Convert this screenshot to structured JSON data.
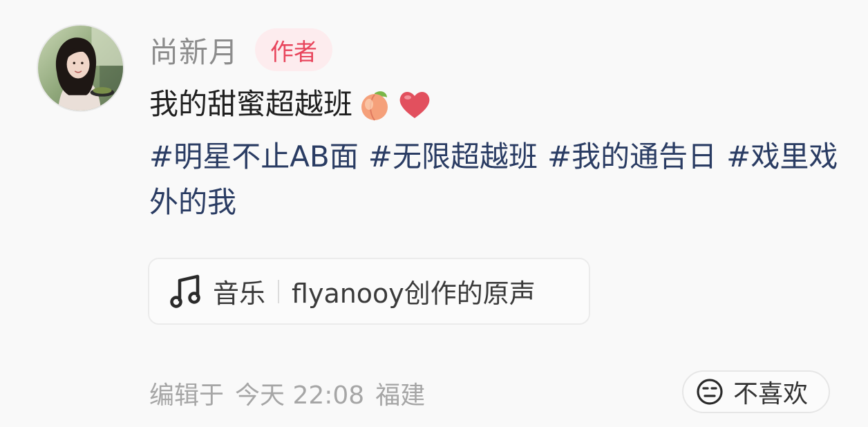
{
  "author": {
    "name": "尚新月",
    "badge": "作者"
  },
  "post": {
    "title": "我的甜蜜超越班",
    "emojis": [
      "peach-emoji",
      "red-heart-emoji"
    ],
    "tags": [
      "#明星不止AB面",
      "#无限超越班",
      "#我的通告日",
      "#戏里戏外的我"
    ]
  },
  "music": {
    "icon": "music-note-icon",
    "label": "音乐",
    "title": "flyanooy创作的原声"
  },
  "footer": {
    "edited_prefix": "编辑于",
    "edited_time": "今天 22:08",
    "location": "福建"
  },
  "dislike": {
    "icon": "neutral-face-icon",
    "label": "不喜欢"
  },
  "colors": {
    "background": "#f9f9f9",
    "badge_bg": "#fdecee",
    "badge_text": "#e8455c",
    "tag_text": "#2a3c63",
    "meta_text": "#a6a6a6"
  }
}
